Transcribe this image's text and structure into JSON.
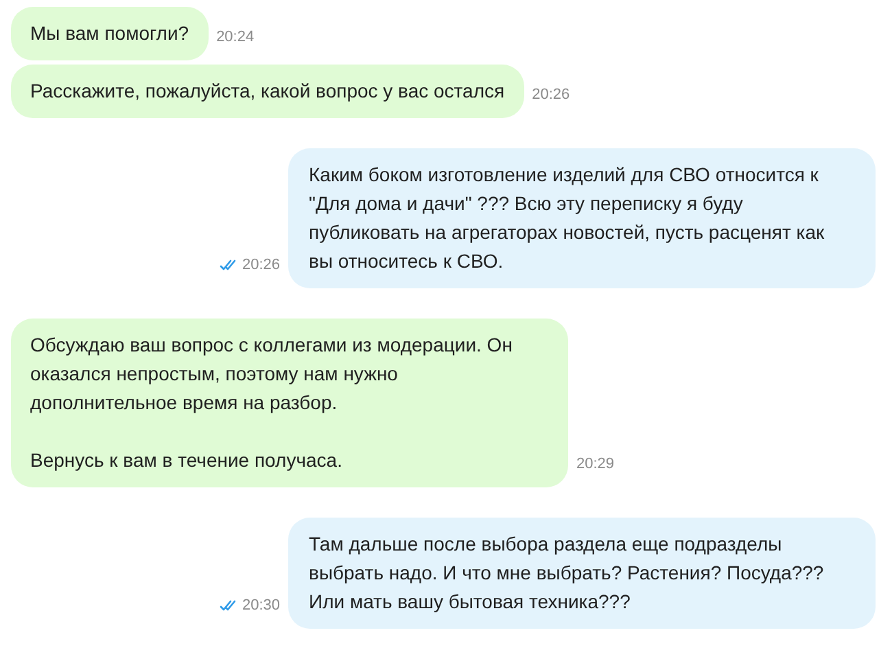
{
  "messages": [
    {
      "kind": "incoming",
      "paragraphs": [
        "Мы вам помогли?"
      ],
      "time": "20:24"
    },
    {
      "kind": "incoming",
      "paragraphs": [
        "Расскажите, пожалуйста, какой вопрос у вас остался"
      ],
      "time": "20:26"
    },
    {
      "kind": "outgoing",
      "paragraphs": [
        "Каким боком изготовление изделий для СВО относится к \"Для дома и дачи\" ??? Всю эту переписку я буду публиковать на агрегаторах новостей, пусть расценят как вы относитесь к СВО."
      ],
      "time": "20:26",
      "read": true
    },
    {
      "kind": "incoming",
      "paragraphs": [
        "Обсуждаю ваш вопрос с коллегами из модерации. Он оказался непростым, поэтому нам нужно дополнительное время на разбор.",
        "Вернусь к вам в течение получаса."
      ],
      "time": "20:29"
    },
    {
      "kind": "outgoing",
      "paragraphs": [
        "Там дальше после выбора раздела еще подразделы выбрать надо. И что мне выбрать? Растения? Посуда??? Или мать вашу бытовая техника???"
      ],
      "time": "20:30",
      "read": true
    }
  ]
}
